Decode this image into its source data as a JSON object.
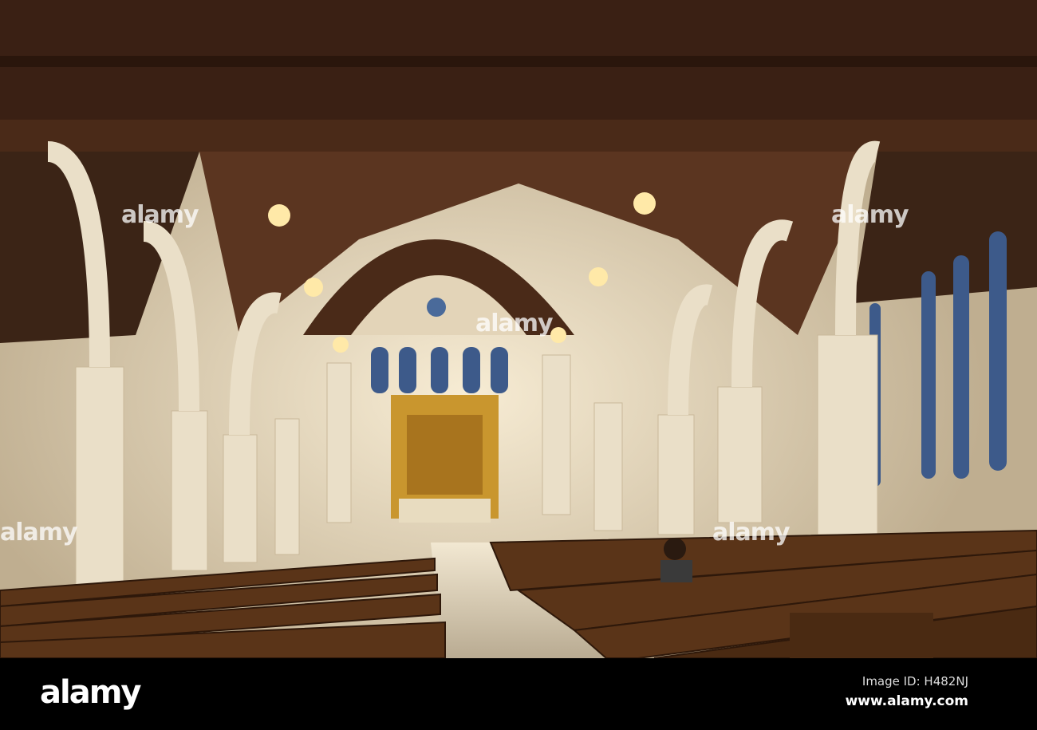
{
  "photo": {
    "subject": "church nave interior",
    "watermark_text": "alamy",
    "colors": {
      "beam": "#3a2014",
      "stone": "#e9dcc4",
      "altar": "#c9962e",
      "pew": "#5a3418",
      "floor": "#d8cbb0"
    }
  },
  "footer": {
    "logo": "alamy",
    "image_id": "Image ID: H482NJ",
    "website": "www.alamy.com"
  }
}
